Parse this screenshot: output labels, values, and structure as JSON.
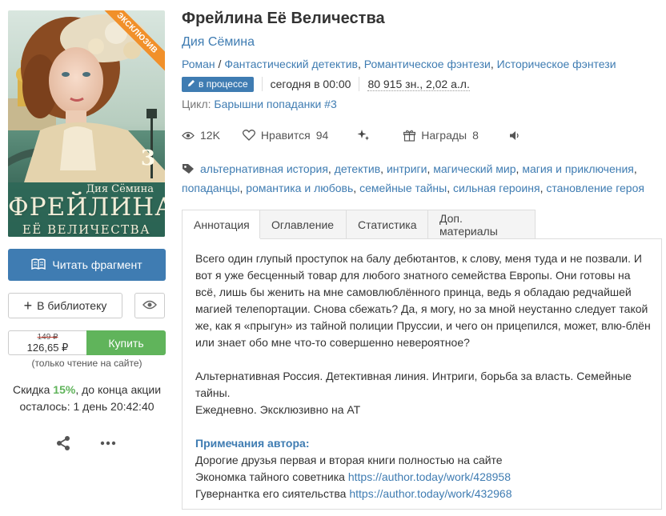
{
  "cover": {
    "badge": "ЭКСКЛЮЗИВ",
    "author": "Дия Сёмина",
    "number": "3",
    "title_line1": "ФРЕЙЛИНА",
    "title_line2": "ЕЁ ВЕЛИЧЕСТВА"
  },
  "actions": {
    "read_fragment": "Читать фрагмент",
    "add_library": "В библиотеку",
    "old_price": "149 ₽",
    "new_price": "126,65 ₽",
    "buy": "Купить",
    "only_read": "(только чтение на сайте)",
    "discount_prefix": "Скидка ",
    "discount_pct": "15%",
    "discount_suffix": ", до конца акции",
    "discount_left": "осталось: 1 день 20:42:40"
  },
  "book": {
    "title": "Фрейлина Её Величества",
    "author": "Дия Сёмина",
    "genres": [
      "Роман",
      "Фантастический детектив",
      "Романтическое фэнтези",
      "Историческое фэнтези"
    ],
    "status_badge": "в процессе",
    "updated": "сегодня в 00:00",
    "volume": "80 915 зн., 2,02 а.л.",
    "cycle_label": "Цикл: ",
    "cycle_name": "Барышни попаданки #3"
  },
  "stats": {
    "views": "12K",
    "likes_label": "Нравится",
    "likes": "94",
    "rewards_label": "Награды",
    "rewards": "8"
  },
  "tags": [
    "альтернативная история",
    "детектив",
    "интриги",
    "магический мир",
    "магия и приключения",
    "попаданцы",
    "романтика и любовь",
    "семейные тайны",
    "сильная героиня",
    "становление героя"
  ],
  "tabs": [
    "Аннотация",
    "Оглавление",
    "Статистика",
    "Доп. материалы"
  ],
  "annotation": {
    "p1": "Всего один глупый проступок на балу дебютантов, к слову, меня туда и не позвали. И вот я уже бесценный товар для любого знатного семейства Европы. Они готовы на всё, лишь бы женить на мне самовлюблённого принца, ведь я обладаю редчайшей магией телепортации. Снова сбежать? Да, я могу, но за мной неустанно следует такой же, как я «прыгун» из тайной полиции Пруссии, и чего он прицепился, может, влю-блён или знает обо мне что-то совершенно невероятное?",
    "p2": "Альтернативная Россия. Детективная линия. Интриги, борьба за власть. Семейные тайны.",
    "p3": "Ежедневно. Эксклюзивно на АТ",
    "notes_head": "Примечания автора:",
    "notes_line1": "Дорогие друзья первая и вторая книги полностью на сайте",
    "notes_line2_text": "Экономка тайного советника ",
    "notes_line2_link": "https://author.today/work/428958",
    "notes_line3_text": "Гувернантка его сиятельства ",
    "notes_line3_link": "https://author.today/work/432968"
  }
}
